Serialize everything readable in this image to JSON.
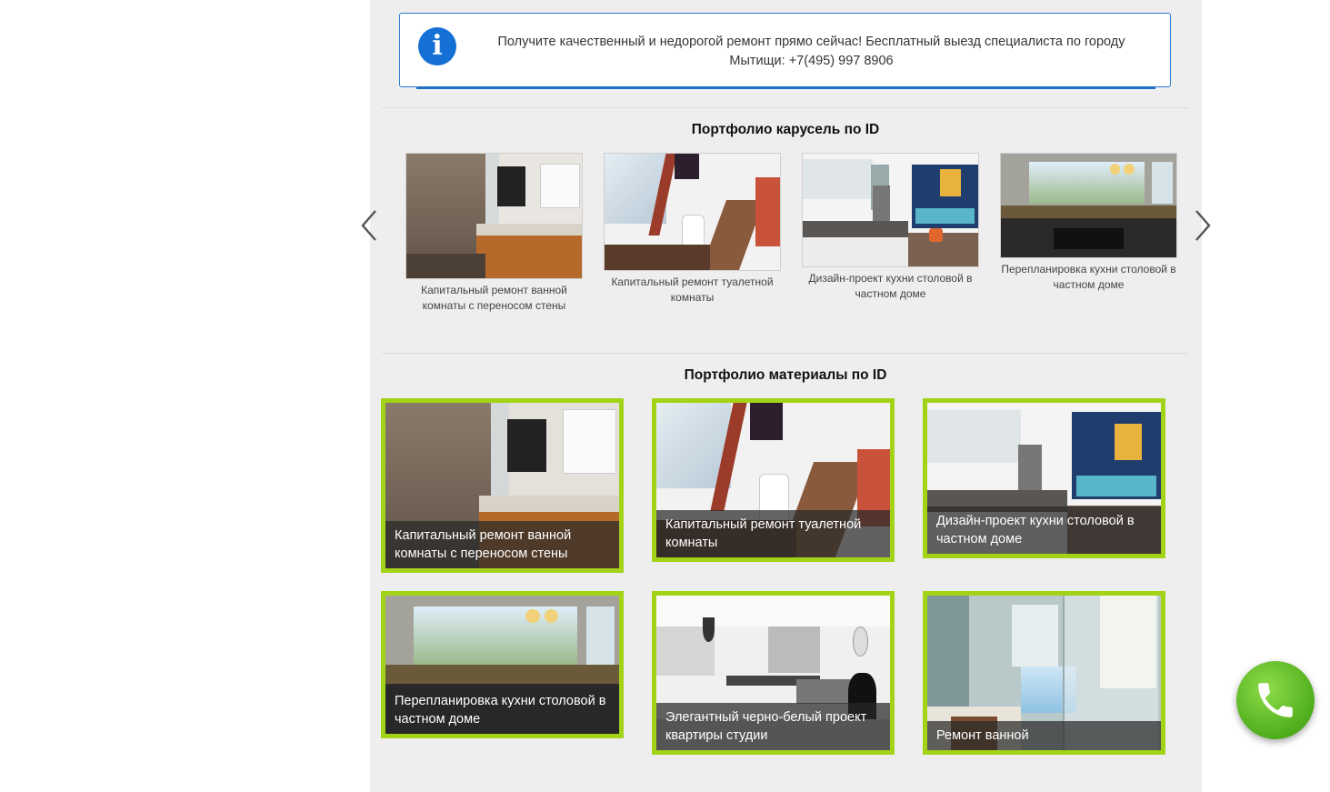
{
  "info": {
    "icon": "info-icon",
    "icon_glyph": "i",
    "message": "Получите качественный и недорогой ремонт прямо сейчас! Бесплатный выезд специалиста по городу Мытищи: +7(495) 997 8906"
  },
  "carousel": {
    "title": "Портфолио карусель по ID",
    "prev_icon": "chevron-left-icon",
    "next_icon": "chevron-right-icon",
    "items": [
      {
        "caption": "Капитальный ремонт ванной комнаты с переносом стены"
      },
      {
        "caption": "Капитальный ремонт туалетной комнаты"
      },
      {
        "caption": "Дизайн-проект кухни столовой в частном доме"
      },
      {
        "caption": "Перепланировка кухни столовой в частном доме"
      }
    ]
  },
  "materials": {
    "title": "Портфолио материалы по ID",
    "items": [
      {
        "caption": "Капитальный ремонт ванной комнаты с переносом стены"
      },
      {
        "caption": "Капитальный ремонт туалетной комнаты"
      },
      {
        "caption": "Дизайн-проект кухни столовой в частном доме"
      },
      {
        "caption": "Перепланировка кухни столовой в частном доме"
      },
      {
        "caption": "Элегантный черно-белый проект квартиры студии"
      },
      {
        "caption": "Ремонт ванной"
      }
    ]
  },
  "call_button": {
    "icon": "phone-icon"
  },
  "colors": {
    "accent_border": "#a3d317",
    "info_blue": "#1570d5",
    "call_green": "#4fae1c",
    "column_bg": "#efeeef"
  }
}
